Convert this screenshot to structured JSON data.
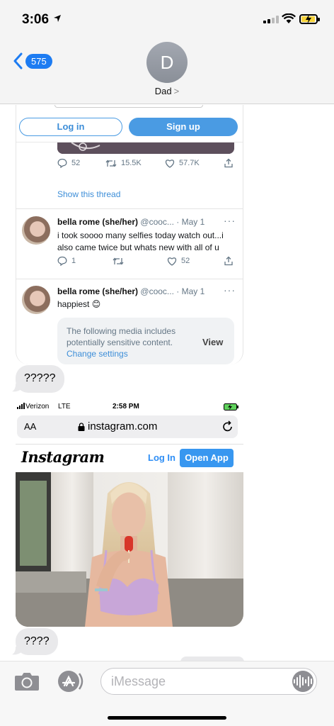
{
  "status_bar": {
    "time": "3:06"
  },
  "header": {
    "back_count": "575",
    "avatar_initial": "D",
    "contact_name": "Dad",
    "contact_chevron": ">"
  },
  "tweet_embed": {
    "login_label": "Log in",
    "signup_label": "Sign up",
    "first_actions": {
      "replies": "52",
      "retweets": "15.5K",
      "likes": "57.7K"
    },
    "show_thread": "Show this thread",
    "reply1": {
      "name": "bella rome (she/her)",
      "handle": "@cooc...",
      "date": "· May 1",
      "text": "i took soooo many selfies today watch out...i also came twice but whats new with all of u",
      "replies": "1",
      "likes": "52"
    },
    "reply2": {
      "name": "bella rome (she/her)",
      "handle": "@cooc...",
      "date": "· May 1",
      "text": "happiest 😊",
      "sensitive_message": "The following media includes potentially sensitive content.",
      "change_settings": "Change settings",
      "view_label": "View"
    }
  },
  "messages": {
    "bubble1": "?????",
    "bubble2": "????"
  },
  "instagram_embed": {
    "carrier": "Verizon",
    "network": "LTE",
    "time": "2:58 PM",
    "text_size": "AA",
    "url": "instagram.com",
    "logo": "Instagram",
    "login_label": "Log In",
    "open_app_label": "Open App"
  },
  "input_bar": {
    "placeholder": "iMessage"
  },
  "colors": {
    "ios_blue": "#1d7cf2",
    "twitter_blue": "#4a9be3",
    "instagram_blue": "#3897f0",
    "bubble_gray": "#e9e9eb"
  }
}
